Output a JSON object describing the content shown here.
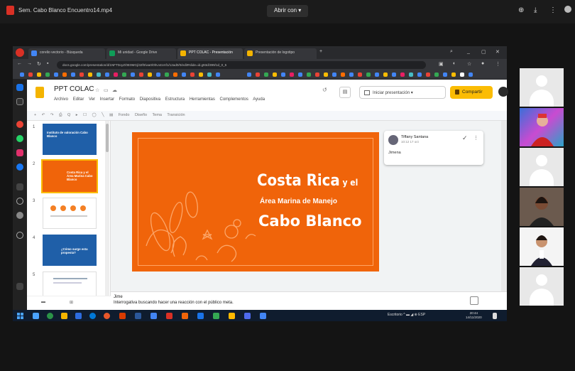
{
  "player": {
    "file_name": "Sem. Cabo Blanco Encuentro14.mp4",
    "open_with": "Abrir con",
    "open_with_caret": "▾",
    "icons": [
      "file-video-icon",
      "add-shortcut-icon",
      "download-icon",
      "more-vert-icon",
      "avatar-icon"
    ]
  },
  "browser": {
    "tabs": [
      {
        "label": "corelio vectorio - Búsqueda",
        "color": "#4285f4"
      },
      {
        "label": "Mi unidad - Google Drive",
        "color": "#0f9d58"
      },
      {
        "label": "PPT COLAC - Presentación",
        "color": "#f4b400"
      },
      {
        "label": "Presentación de logotipo",
        "color": "#f4b400"
      }
    ],
    "active_tab": 2,
    "url": "docs.google.com/presentation/d/1NFT0oyZ/0E0MGj/32f0/wa0/0hUxt1mf1/12ad0/0/edit#slide=id.g93d/399/1d_0_5"
  },
  "slides_app": {
    "title": "PPT COLAC",
    "title_icons": [
      "star-icon",
      "move-to-folder-icon",
      "cloud-status-icon"
    ],
    "menu": [
      "Archivo",
      "Editar",
      "Ver",
      "Insertar",
      "Formato",
      "Diapositiva",
      "Estructura",
      "Herramientas",
      "Complementos",
      "Ayuda"
    ],
    "present_label": "Iniciar presentación",
    "share_label": "Compartir",
    "toolbar": [
      "+",
      "↶",
      "↷",
      "⎙",
      "Q",
      "▸",
      "☐",
      "◯",
      "╲",
      "▤",
      "Fondo",
      "Diseño",
      "Tema",
      "Transición"
    ]
  },
  "thumbnails": [
    {
      "num": "1",
      "text": "Instituto de valoración Cabo Blanco",
      "bg": "#1f5fa8"
    },
    {
      "num": "2",
      "text": "Costa Rica y el Área Marina Cabo Blanco",
      "bg": "#f0640a"
    },
    {
      "num": "3",
      "text": "",
      "bg": "#ffffff"
    },
    {
      "num": "4",
      "text": "¿Cómo surge esta propesta?",
      "bg": "#1f5fa8"
    },
    {
      "num": "5",
      "text": "",
      "bg": "#ffffff"
    }
  ],
  "slide": {
    "line1_main": "Costa Rica",
    "line1_small": " y el",
    "line2": "Área Marina de Manejo",
    "line3": "Cabo Blanco",
    "bg_color": "#f0640a"
  },
  "comment": {
    "author": "Tiffany Santana",
    "time": "10:12 17 oct",
    "body": "Jimena"
  },
  "notes": {
    "line1": "Jime",
    "line2": "Interrogativa buscando hacer una reacción con el público meta."
  },
  "taskbar": {
    "tray": "Escritorio  ^  ▬  ◢  ⊕  ESP",
    "time": "20:44",
    "date": "14/11/2020",
    "app_colors": [
      "#4aa3ff",
      "#2b9348",
      "#f4b400",
      "#2d6cdf",
      "#0078d7",
      "#e8572a",
      "#d83b01",
      "#2b579a",
      "#4285f4",
      "#ffffff",
      "#1a73e8",
      "#d93025",
      "#34a853",
      "#ffb900",
      "#4f6bed",
      "#4285f4"
    ]
  },
  "participants": [
    {
      "type": "silhouette"
    },
    {
      "type": "video",
      "desc": "person-colorful-bg"
    },
    {
      "type": "silhouette"
    },
    {
      "type": "video",
      "desc": "person-dark"
    },
    {
      "type": "video",
      "desc": "person-white"
    },
    {
      "type": "silhouette"
    }
  ]
}
